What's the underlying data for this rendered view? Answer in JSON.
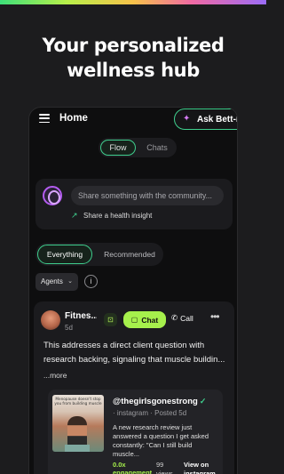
{
  "hero": {
    "title_line1": "Your personalized",
    "title_line2": "wellness hub"
  },
  "header": {
    "title": "Home",
    "ask_label": "Ask Bett-I"
  },
  "view_toggle": {
    "flow": "Flow",
    "chats": "Chats"
  },
  "composer": {
    "placeholder": "Share something with the community...",
    "insight_label": "Share a health insight"
  },
  "filters": {
    "everything": "Everything",
    "recommended": "Recommended",
    "agents": "Agents"
  },
  "post": {
    "author": "Fitnes...",
    "time": "5d",
    "chat_label": "Chat",
    "call_label": "Call",
    "body": "This addresses a direct client question with research backing, signaling that muscle buildin...",
    "more": "...more",
    "embed": {
      "thumb_text": "Menopause doesn't stop you from building muscle",
      "handle": "@thegirlsgonestrong",
      "meta": "· instagram · Posted 5d",
      "description": "A new research review just answered a question I get asked constantly: \"Can I still build muscle...",
      "engagement_value": "0.0x",
      "engagement_label": "engagement",
      "views_value": "99",
      "views_label": "views",
      "view_on_line1": "View on",
      "view_on_line2": "instagram"
    }
  },
  "colors": {
    "accent_green": "#3fcf8e",
    "chat_lime": "#a6f04c",
    "avatar_purple": "#b45cf0"
  },
  "icons": [
    "menu-icon",
    "sparkle-icon",
    "trend-icon",
    "chevron-down-icon",
    "info-icon",
    "bot-icon",
    "chat-icon",
    "phone-icon",
    "more-icon",
    "verified-icon"
  ]
}
